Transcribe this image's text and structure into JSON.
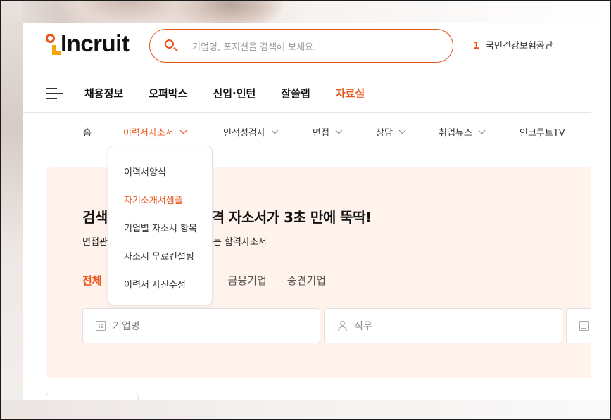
{
  "header": {
    "logo_text": "Incruit",
    "search_placeholder": "기업명, 포지션을 검색해 보세요.",
    "rank": {
      "number": "1",
      "label": "국민건강보험공단"
    }
  },
  "gnb": [
    {
      "label": "채용정보",
      "active": false
    },
    {
      "label": "오퍼박스",
      "active": false
    },
    {
      "label": "신입·인턴",
      "active": false
    },
    {
      "label": "잘쓸랩",
      "active": false
    },
    {
      "label": "자료실",
      "active": true
    }
  ],
  "subnav": [
    {
      "label": "홈",
      "has_dropdown": false
    },
    {
      "label": "이력서자소서",
      "has_dropdown": true,
      "active": true
    },
    {
      "label": "인적성검사",
      "has_dropdown": true
    },
    {
      "label": "면접",
      "has_dropdown": true
    },
    {
      "label": "상담",
      "has_dropdown": true
    },
    {
      "label": "취업뉴스",
      "has_dropdown": true
    },
    {
      "label": "인크루트TV",
      "has_dropdown": false
    }
  ],
  "dropdown": {
    "items": [
      {
        "label": "이력서양식",
        "active": false
      },
      {
        "label": "자기소개서샘플",
        "active": true
      },
      {
        "label": "기업별 자소서 항목",
        "active": false
      },
      {
        "label": "자소서 무료컨설팅",
        "active": false
      },
      {
        "label": "이력서 사진수정",
        "active": false
      }
    ]
  },
  "hero": {
    "title_left": "검색",
    "title_right": "합격 자소서가 3초 만에 뚝딱!",
    "sub_left": "면접관",
    "sub_right": "넘는 합격자소서",
    "tabs": [
      {
        "label": "전체",
        "active": true
      },
      {
        "label": "금융기업",
        "active": false
      },
      {
        "label": "중견기업",
        "active": false
      }
    ],
    "fields": [
      {
        "placeholder": "기업명",
        "icon": "building-icon"
      },
      {
        "placeholder": "직무",
        "icon": "person-icon"
      },
      {
        "placeholder": "",
        "icon": "document-icon"
      }
    ]
  },
  "colors": {
    "accent": "#e9541a",
    "logo_yellow": "#f5a700",
    "hero_bg": "#fff3ec"
  }
}
